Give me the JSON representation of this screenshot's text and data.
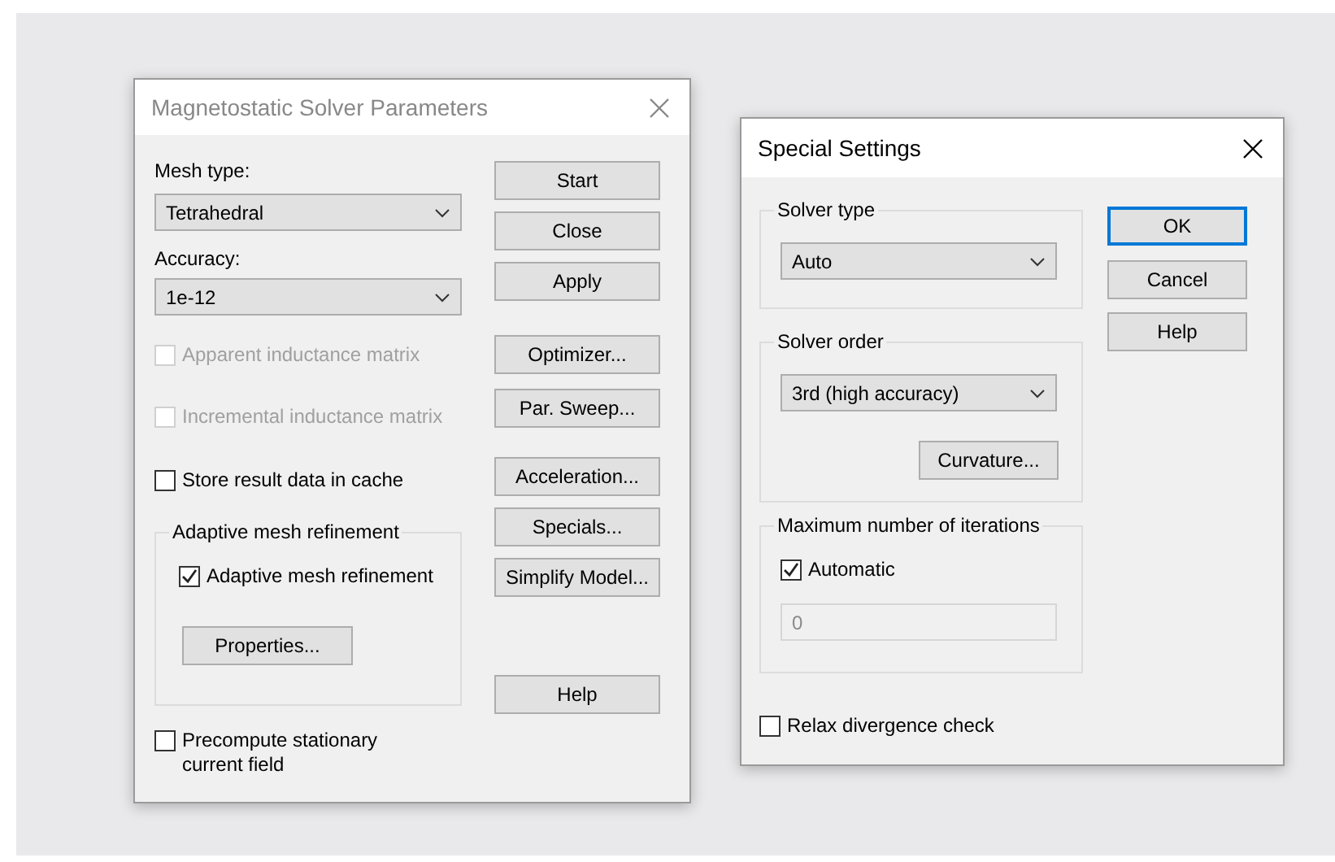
{
  "main_dialog": {
    "title": "Magnetostatic Solver Parameters",
    "active": false,
    "fields": [
      {
        "label": "Mesh type:",
        "value": "Tetrahedral"
      },
      {
        "label": "Accuracy:",
        "value": "1e-12"
      }
    ],
    "checkboxes": [
      {
        "label": "Apparent inductance matrix",
        "checked": false,
        "disabled": true
      },
      {
        "label": "Incremental inductance matrix",
        "checked": false,
        "disabled": true
      },
      {
        "label": "Store result data in cache",
        "checked": false,
        "disabled": false
      }
    ],
    "group": {
      "title": "Adaptive mesh refinement",
      "checkbox": {
        "label": "Adaptive mesh refinement",
        "checked": true
      },
      "button": "Properties..."
    },
    "bottom_checkbox": {
      "label": "Precompute stationary current field",
      "checked": false
    },
    "buttons": [
      "Start",
      "Close",
      "Apply",
      "Optimizer...",
      "Par. Sweep...",
      "Acceleration...",
      "Specials...",
      "Simplify Model...",
      "Help"
    ]
  },
  "special_dialog": {
    "title": "Special Settings",
    "active": true,
    "groups": [
      {
        "title": "Solver type",
        "select": "Auto"
      },
      {
        "title": "Solver order",
        "select": "3rd (high accuracy)",
        "button": "Curvature..."
      },
      {
        "title": "Maximum number of iterations",
        "checkbox": {
          "label": "Automatic",
          "checked": true
        },
        "input": {
          "value": "0",
          "disabled": true
        }
      }
    ],
    "bottom_checkbox": {
      "label": "Relax divergence check",
      "checked": false
    },
    "buttons": [
      {
        "label": "OK",
        "focused": true
      },
      {
        "label": "Cancel",
        "focused": false
      },
      {
        "label": "Help",
        "focused": false
      }
    ]
  }
}
